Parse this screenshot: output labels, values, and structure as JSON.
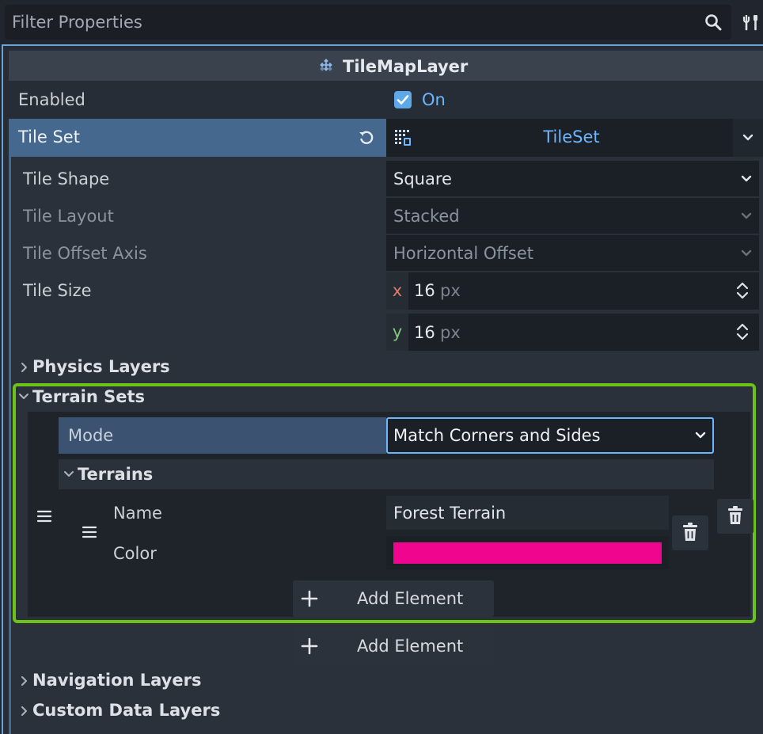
{
  "filter": {
    "placeholder": "Filter Properties"
  },
  "header": {
    "class_name": "TileMapLayer"
  },
  "enabled": {
    "label": "Enabled",
    "value": "On",
    "checked": true
  },
  "tile_set": {
    "label": "Tile Set",
    "value": "TileSet"
  },
  "tile_shape": {
    "label": "Tile Shape",
    "value": "Square"
  },
  "tile_layout": {
    "label": "Tile Layout",
    "value": "Stacked"
  },
  "tile_offset_axis": {
    "label": "Tile Offset Axis",
    "value": "Horizontal Offset"
  },
  "tile_size": {
    "label": "Tile Size",
    "x": {
      "axis": "x",
      "value": "16",
      "unit": "px"
    },
    "y": {
      "axis": "y",
      "value": "16",
      "unit": "px"
    }
  },
  "sections": {
    "physics_layers": "Physics Layers",
    "terrain_sets": "Terrain Sets",
    "navigation_layers": "Navigation Layers",
    "custom_data_layers": "Custom Data Layers"
  },
  "terrain_set": {
    "mode_label": "Mode",
    "mode_value": "Match Corners and Sides",
    "terrains_label": "Terrains",
    "terrain": {
      "name_label": "Name",
      "name_value": "Forest Terrain",
      "color_label": "Color",
      "color_value": "#f0058f"
    },
    "add_terrain_label": "Add Element"
  },
  "add_terrain_set_label": "Add Element",
  "colors": {
    "accent": "#6cb6ff",
    "highlight": "#6cc318",
    "selected_row": "#45688f"
  }
}
